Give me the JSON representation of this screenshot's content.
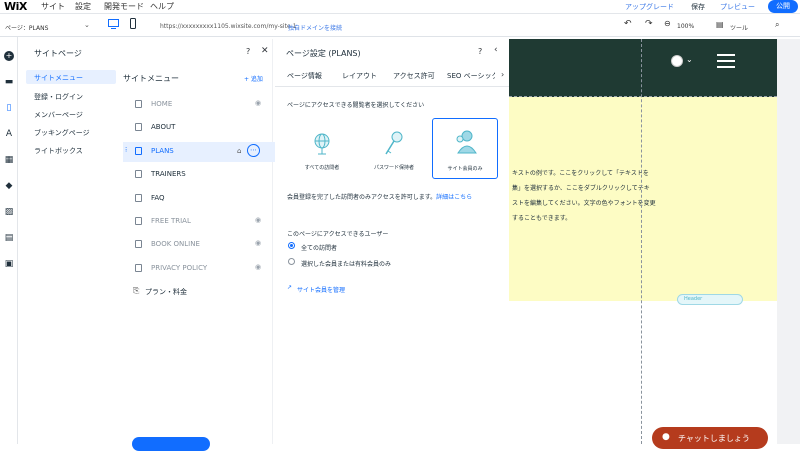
{
  "topbar": {
    "logo": "WiX",
    "menu": [
      "サイト",
      "設定",
      "開発モード",
      "ヘルプ"
    ],
    "upgrade": "アップグレード",
    "save": "保存",
    "preview": "プレビュー",
    "publish": "公開"
  },
  "subbar": {
    "page_selector": "ページ：PLANS",
    "url": "https://xxxxxxxxx1105.wixsite.com/my-site-1",
    "connect_domain": "独自ドメインを接続",
    "zoom": "100%",
    "tools": "ツール"
  },
  "pages_panel": {
    "title": "サイトページ",
    "left_menu": [
      "サイトメニュー",
      "登録・ログイン",
      "メンバーページ",
      "ブッキングページ",
      "ライトボックス"
    ],
    "column_title": "サイトメニュー",
    "add": "+ 追加",
    "pages": [
      {
        "label": "HOME",
        "hidden": true
      },
      {
        "label": "ABOUT",
        "hidden": false
      },
      {
        "label": "PLANS",
        "hidden": false
      },
      {
        "label": "TRAINERS",
        "hidden": false
      },
      {
        "label": "FAQ",
        "hidden": false
      },
      {
        "label": "FREE TRIAL",
        "hidden": true
      },
      {
        "label": "BOOK ONLINE",
        "hidden": true
      },
      {
        "label": "PRIVACY POLICY",
        "hidden": true
      }
    ],
    "plans_item": "プラン・料金"
  },
  "settings": {
    "title": "ページ設定 (PLANS)",
    "tabs": [
      "ページ情報",
      "レイアウト",
      "アクセス許可",
      "SEO ベーシック"
    ],
    "prompt": "ページにアクセスできる閲覧者を選択してください",
    "options": [
      "すべての訪問者",
      "パスワード保持者",
      "サイト会員のみ"
    ],
    "member_note": "会員登録を完了した訪問者のみアクセスを許可します。",
    "details_link": "詳細はこちら",
    "who_title": "このページにアクセスできるユーザー",
    "radio_options": [
      "全ての訪問者",
      "選択した会員または有料会員のみ"
    ],
    "manage_link": "サイト会員を管理"
  },
  "canvas": {
    "text_lines": [
      "キストの例です。ここをクリックして「テキストを",
      "集」を選択するか、ここをダブルクリックしてテキ",
      "ストを編集してください。文字の色やフォントを変更",
      "することもできます。"
    ],
    "strip_tag": "Header",
    "chat": "チャットしましょう"
  },
  "colors": {
    "accent": "#116dff",
    "header_dark": "#1f3a33",
    "yellow_section": "#fdfcc4",
    "chat_button": "#b53b1d",
    "selected_row": "#e7f0ff"
  }
}
